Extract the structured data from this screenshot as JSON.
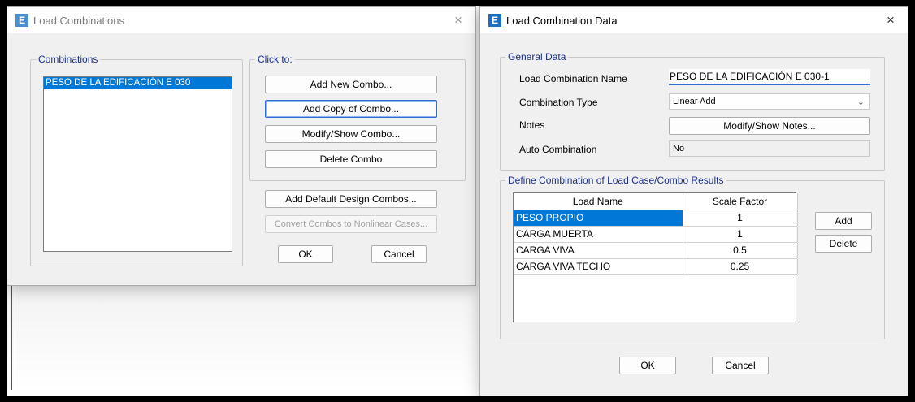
{
  "win1": {
    "title": "Load Combinations",
    "icon_letter": "E",
    "close": "×",
    "combinations_label": "Combinations",
    "combinations": [
      "PESO DE LA EDIFICACIÓN E 030"
    ],
    "click_to_label": "Click to:",
    "buttons": {
      "add_new": "Add New Combo...",
      "add_copy": "Add Copy of Combo...",
      "modify_show": "Modify/Show Combo...",
      "delete": "Delete Combo",
      "add_default": "Add Default Design Combos...",
      "convert": "Convert Combos to Nonlinear Cases...",
      "ok": "OK",
      "cancel": "Cancel"
    }
  },
  "win2": {
    "title": "Load Combination Data",
    "icon_letter": "E",
    "close": "×",
    "general_label": "General Data",
    "name_label": "Load Combination Name",
    "name_value": "PESO DE LA EDIFICACIÓN E 030-1",
    "type_label": "Combination Type",
    "type_value": "Linear Add",
    "notes_label": "Notes",
    "notes_button": "Modify/Show Notes...",
    "auto_label": "Auto Combination",
    "auto_value": "No",
    "define_label": "Define Combination of Load Case/Combo Results",
    "col_load_name": "Load Name",
    "col_scale_factor": "Scale Factor",
    "rows": [
      {
        "name": "PESO PROPIO",
        "factor": "1"
      },
      {
        "name": "CARGA MUERTA",
        "factor": "1"
      },
      {
        "name": "CARGA VIVA",
        "factor": "0.5"
      },
      {
        "name": "CARGA VIVA TECHO",
        "factor": "0.25"
      }
    ],
    "add_button": "Add",
    "delete_button": "Delete",
    "ok": "OK",
    "cancel": "Cancel"
  },
  "colors": {
    "selection": "#0078d7",
    "group_label": "#1c2f8e",
    "focus": "#2f6fd1"
  }
}
